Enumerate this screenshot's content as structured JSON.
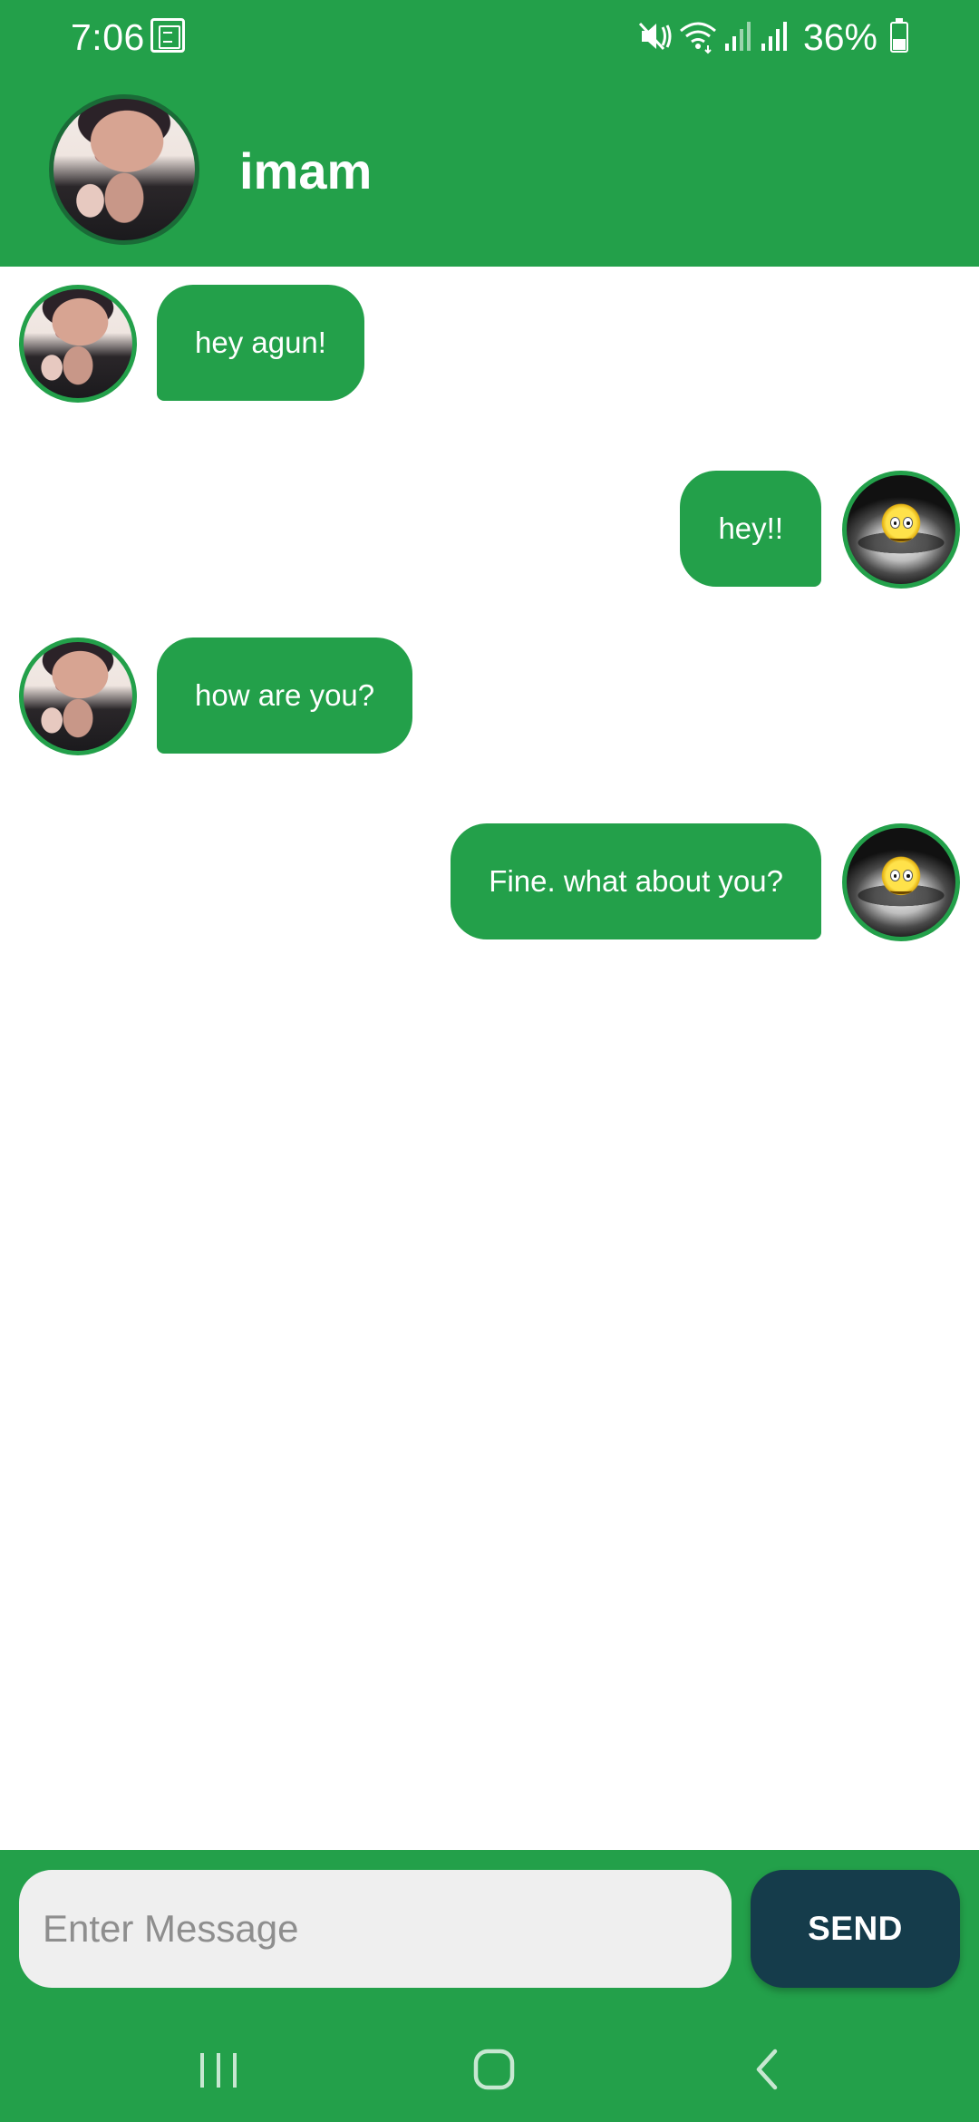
{
  "status_bar": {
    "time": "7:06",
    "battery": "36%",
    "icons": [
      "news-icon",
      "mute-vibrate-icon",
      "wifi-icon",
      "signal-icon",
      "signal-icon",
      "battery-icon"
    ]
  },
  "header": {
    "contact_name": "imam",
    "avatar": "contact-avatar"
  },
  "messages": [
    {
      "direction": "incoming",
      "text": "hey agun!",
      "avatar": "contact-avatar"
    },
    {
      "direction": "outgoing",
      "text": "hey!!",
      "avatar": "emoji-avatar"
    },
    {
      "direction": "incoming",
      "text": "how are you?",
      "avatar": "contact-avatar"
    },
    {
      "direction": "outgoing",
      "text": "Fine. what about you?",
      "avatar": "emoji-avatar"
    }
  ],
  "composer": {
    "placeholder": "Enter Message",
    "value": "",
    "send_label": "SEND"
  },
  "nav_bar": {
    "icons": [
      "recent-apps-icon",
      "home-icon",
      "back-icon"
    ]
  },
  "colors": {
    "primary": "#23a04a",
    "bubble_text": "#ffffff",
    "send_button": "#153c4b",
    "input_background": "#efefef"
  }
}
